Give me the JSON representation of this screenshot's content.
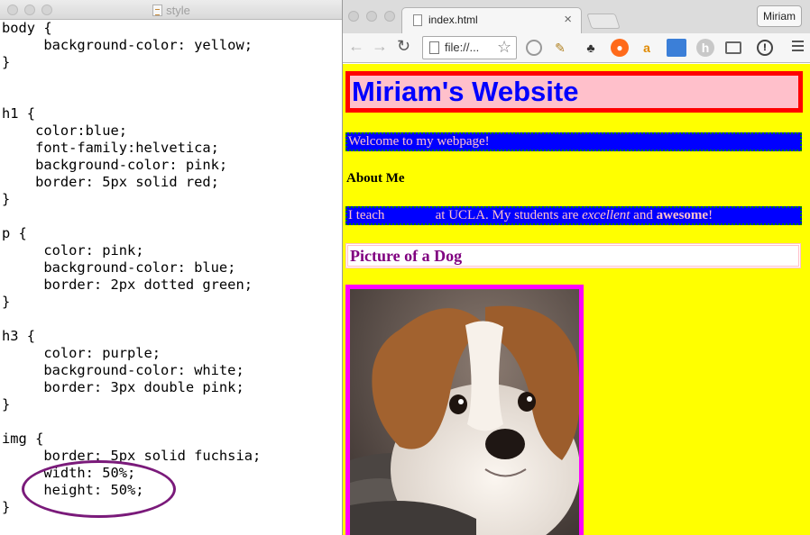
{
  "editor": {
    "title": "style",
    "code_lines": [
      "body {",
      "     background-color: yellow;",
      "}",
      "",
      "",
      "h1 {",
      "    color:blue;",
      "    font-family:helvetica;",
      "    background-color: pink;",
      "    border: 5px solid red;",
      "}",
      "",
      "p {",
      "     color: pink;",
      "     background-color: blue;",
      "     border: 2px dotted green;",
      "}",
      "",
      "h3 {",
      "     color: purple;",
      "     background-color: white;",
      "     border: 3px double pink;",
      "}",
      "",
      "img {",
      "     border: 5px solid fuchsia;",
      "     width: 50%;",
      "     height: 50%;",
      "}"
    ]
  },
  "browser": {
    "tab_title": "index.html",
    "tab_close": "×",
    "profile_name": "Miriam",
    "url": "file://...",
    "nav": {
      "back": "←",
      "forward": "→",
      "reload": "↻",
      "star": "☆"
    }
  },
  "webpage": {
    "heading": "Miriam's Website",
    "welcome": "Welcome to my webpage!",
    "about_heading": "About Me",
    "teach_prefix": "I teach               at UCLA. My students are ",
    "teach_emphasis": "excellent",
    "teach_middle": " and ",
    "teach_strong": "awesome",
    "teach_suffix": "!",
    "picture_heading": "Picture of a Dog"
  },
  "colors": {
    "page_background": "#ffff00",
    "h1_text": "#0000ff",
    "h1_background": "#ffc0cb",
    "h1_border": "#ff0000",
    "p_text": "#ffc0cb",
    "p_background": "#0000ff",
    "p_border": "#008000",
    "h3_text": "#800080",
    "img_border": "#ff00ff",
    "annotation_circle": "#7a1a7a"
  }
}
